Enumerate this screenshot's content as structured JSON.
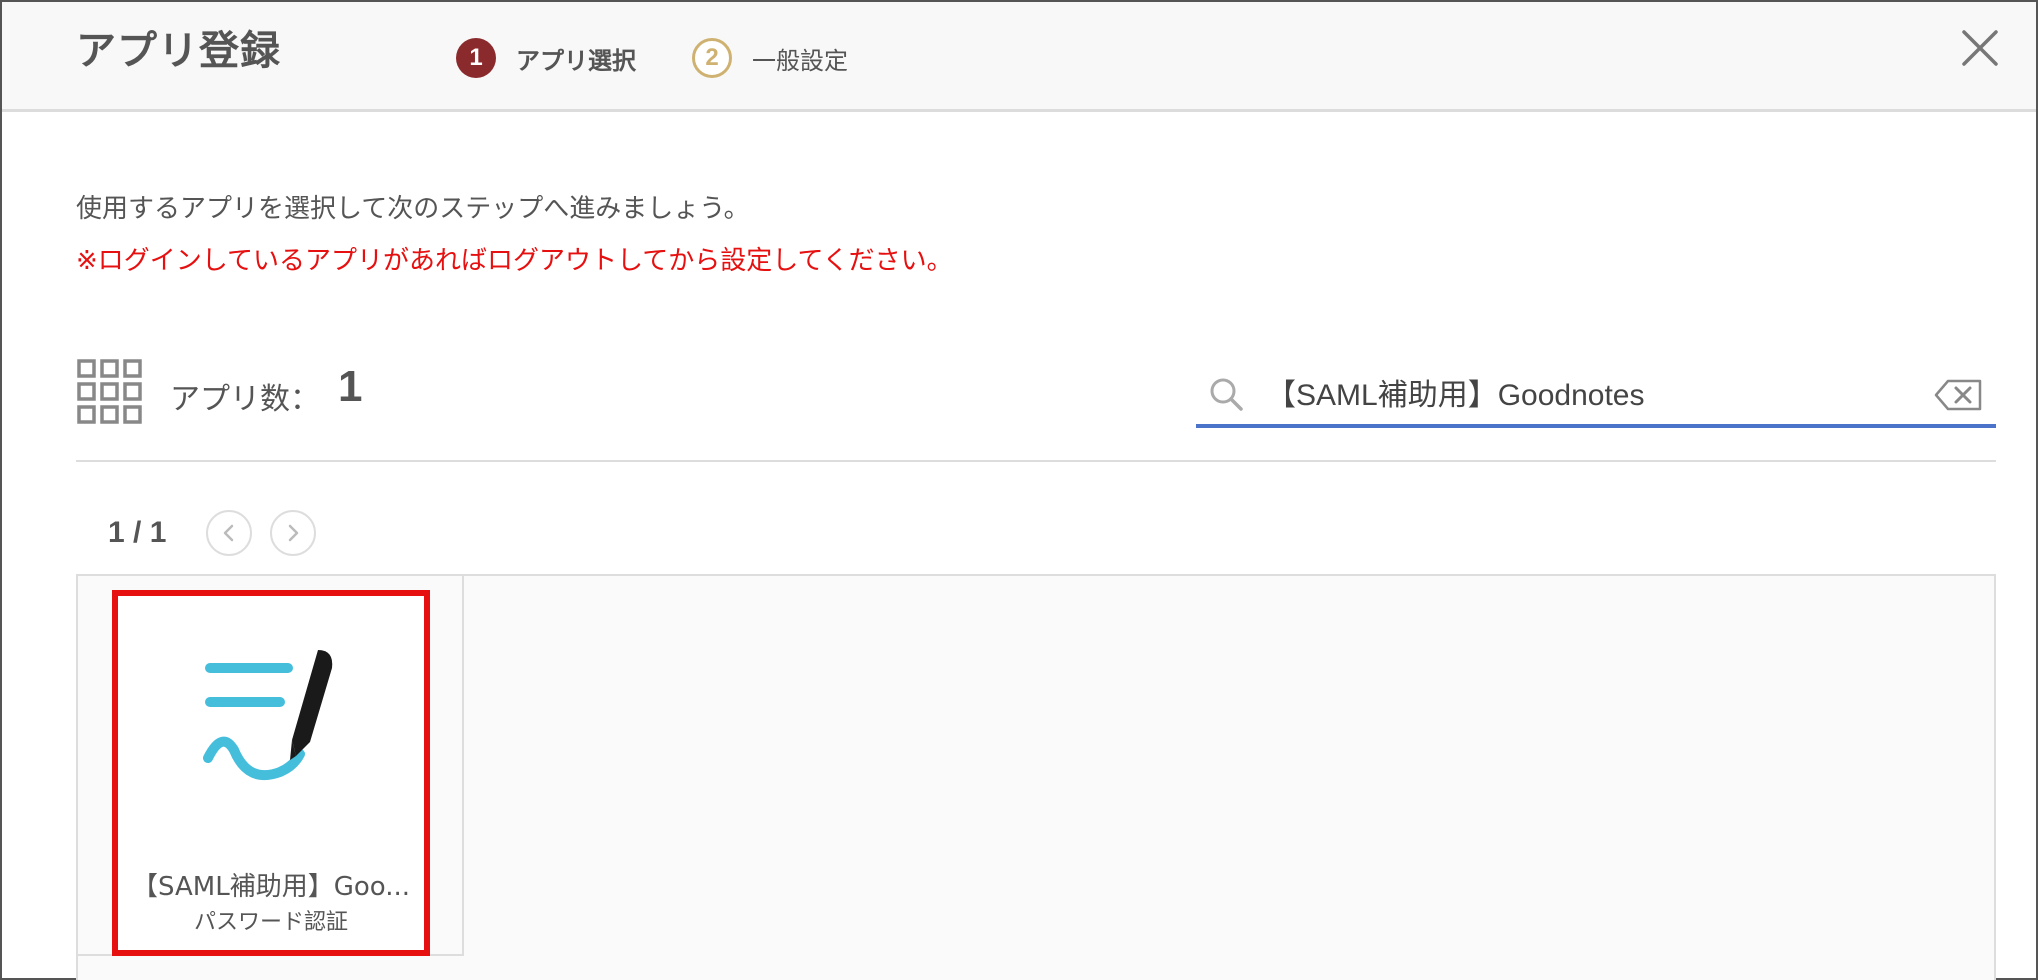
{
  "header": {
    "title": "アプリ登録",
    "steps": [
      {
        "number": "1",
        "label": "アプリ選択",
        "active": true
      },
      {
        "number": "2",
        "label": "一般設定",
        "active": false
      }
    ],
    "close_icon": "close-icon"
  },
  "instructions": {
    "main": "使用するアプリを選択して次のステップへ進みましょう。",
    "warning": "※ログインしているアプリがあればログアウトしてから設定してください。"
  },
  "toolbar": {
    "grid_icon": "grid-icon",
    "count_label": "アプリ数：",
    "count_value": "1"
  },
  "search": {
    "value": "【SAML補助用】Goodnotes",
    "icon": "search-icon",
    "clear_icon": "backspace-clear-icon"
  },
  "pagination": {
    "text": "1 / 1",
    "prev_icon": "chevron-left-icon",
    "next_icon": "chevron-right-icon"
  },
  "apps": [
    {
      "name": "【SAML補助用】Goo...",
      "auth": "パスワード認証",
      "logo": "goodnotes-logo",
      "selected": true
    }
  ],
  "colors": {
    "step_active": "#8b2a2c",
    "step_inactive": "#cfb272",
    "warning": "#e61010",
    "search_underline": "#4a73c9",
    "selection_border": "#e61010",
    "logo_blue": "#45bedc",
    "logo_pen": "#1a1a1a"
  }
}
